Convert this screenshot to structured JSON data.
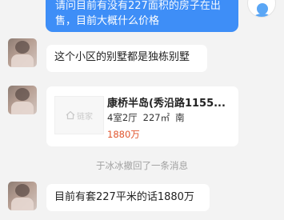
{
  "messages": {
    "sent": {
      "line1": "请问目前有没有227面积的房子在出",
      "line2": "售，目前大概什么价格"
    },
    "reply1": "这个小区的别墅都是独栋别墅",
    "listing": {
      "title": "康桥半岛(秀沿路1155...",
      "rooms": "4室2厅",
      "area": "227㎡",
      "orientation": "南",
      "price": "1880万",
      "watermark": "链家"
    },
    "system_notice": "于冰冰撤回了一条消息",
    "reply2": "目前有套227平米的话1880万"
  },
  "colors": {
    "sent_bubble": "#3e8ef7",
    "price": "#e0552d",
    "background": "#f3f3f3"
  }
}
